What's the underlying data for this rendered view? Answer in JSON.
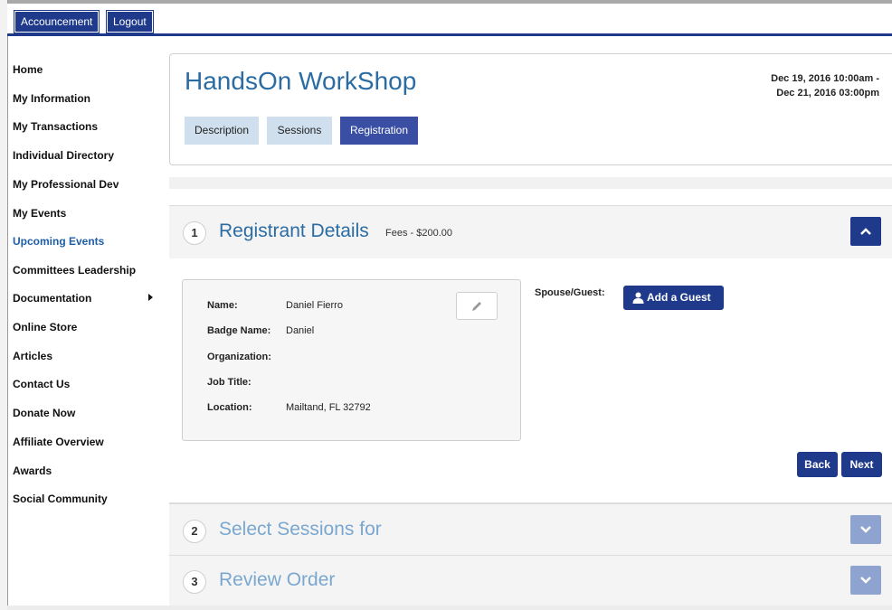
{
  "top_tabs": {
    "account": "Accouncement",
    "logout": "Logout"
  },
  "sidebar": {
    "items": [
      {
        "label": "Home"
      },
      {
        "label": "My Information"
      },
      {
        "label": "My Transactions"
      },
      {
        "label": "Individual Directory"
      },
      {
        "label": "My Professional Dev"
      },
      {
        "label": "My Events"
      },
      {
        "label": "Upcoming Events"
      },
      {
        "label": "Committees Leadership"
      },
      {
        "label": "Documentation"
      },
      {
        "label": "Online Store"
      },
      {
        "label": "Articles"
      },
      {
        "label": "Contact Us"
      },
      {
        "label": "Donate Now"
      },
      {
        "label": "Affiliate Overview"
      },
      {
        "label": "Awards"
      },
      {
        "label": "Social Community"
      }
    ]
  },
  "event": {
    "title": "HandsOn WorkShop",
    "date_line1": "Dec 19, 2016 10:00am -",
    "date_line2": "Dec 21, 2016 03:00pm",
    "tabs": [
      "Description",
      "Sessions",
      "Registration"
    ]
  },
  "steps": [
    {
      "number": "1",
      "title": "Registrant Details",
      "fees": "Fees - $200.00"
    },
    {
      "number": "2",
      "title": "Select Sessions for"
    },
    {
      "number": "3",
      "title": "Review Order"
    }
  ],
  "registrant": {
    "name_label": "Name:",
    "name": "Daniel Fierro",
    "badge_label": "Badge Name:",
    "badge": "Daniel",
    "org_label": "Organization:",
    "org": "",
    "job_label": "Job Title:",
    "job": "",
    "location_label": "Location:",
    "location": "Mailtand, FL 32792"
  },
  "guest": {
    "label": "Spouse/Guest:",
    "button": "Add a Guest"
  },
  "buttons": {
    "back": "Back",
    "next": "Next"
  },
  "icons": {
    "edit": "pencil-icon",
    "guest": "user-icon",
    "expand_open": "chevron-up-icon",
    "expand_closed": "chevron-down-icon",
    "submenu": "caret-right-icon"
  },
  "colors": {
    "primary": "#1f3a8a",
    "link": "#2b6ca3",
    "tab_inactive": "#cfdfee"
  }
}
